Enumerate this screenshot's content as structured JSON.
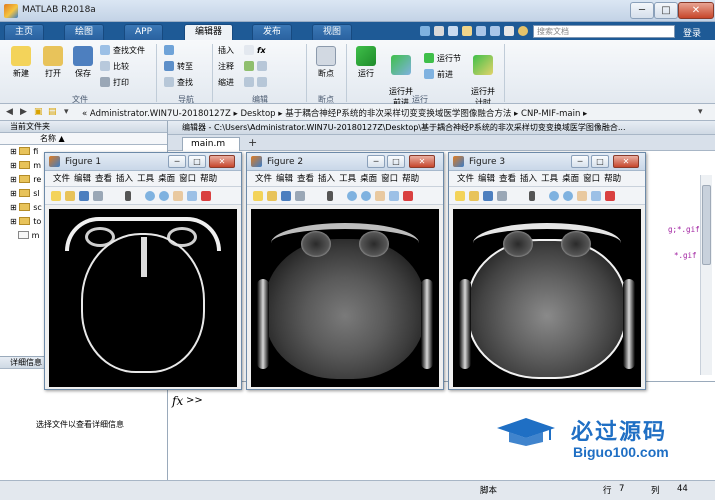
{
  "window": {
    "title": "MATLAB R2018a",
    "minimize": "─",
    "maximize": "□",
    "close": "✕"
  },
  "tabs": [
    {
      "label": "主页"
    },
    {
      "label": "绘图"
    },
    {
      "label": "APP"
    },
    {
      "label": "编辑器"
    },
    {
      "label": "发布"
    },
    {
      "label": "视图"
    }
  ],
  "search": {
    "placeholder": "搜索文档"
  },
  "login": "登录",
  "ribbon": {
    "file": {
      "new": "新建",
      "open": "打开",
      "save": "保存",
      "find_files": "查找文件",
      "compare": "比较",
      "print": "打印",
      "group": "文件"
    },
    "nav": {
      "goto": "转至",
      "find": "查找",
      "group": "导航"
    },
    "edit": {
      "insert": "插入",
      "comment": "注释",
      "indent": "缩进",
      "fx": "fx",
      "group": "编辑"
    },
    "breakpoint": {
      "label": "断点",
      "group": "断点"
    },
    "run": {
      "run": "运行",
      "run_advance": "运行并\n前进",
      "run_section": "运行节",
      "advance": "前进",
      "run_time": "运行并\n计时",
      "group": "运行"
    }
  },
  "address": {
    "path": "« Administrator.WIN7U-20180127Z  ▸  Desktop  ▸  基于耦合神经P系统的非次采样切变变换域医学图像融合方法  ▸  CNP-MIF-main  ▸"
  },
  "left_panel": {
    "title": "当前文件夹",
    "column": "名称",
    "sort": "▲",
    "items": [
      {
        "label": "fi"
      },
      {
        "label": "m"
      },
      {
        "label": "re"
      },
      {
        "label": "sl"
      },
      {
        "label": "sc"
      },
      {
        "label": "to"
      },
      {
        "label": "m"
      }
    ]
  },
  "detail_panel": {
    "title": "详细信息",
    "message": "选择文件以查看详细信息"
  },
  "editor": {
    "header": "编辑器 - C:\\Users\\Administrator.WIN7U-20180127Z\\Desktop\\基于耦合神经P系统的非次采样切变变换域医学图像融合...",
    "tab": "main.m",
    "add": "+",
    "code_fragments": [
      "g;*.gif",
      "*.gif"
    ]
  },
  "command": {
    "prompt": ">>"
  },
  "status": {
    "script": "脚本",
    "row_label": "行",
    "row": "7",
    "col_label": "列",
    "col": "44"
  },
  "figures": [
    {
      "title": "Figure 1"
    },
    {
      "title": "Figure 2"
    },
    {
      "title": "Figure 3"
    }
  ],
  "figure_menu": [
    "文件",
    "编辑",
    "查看",
    "插入",
    "工具",
    "桌面",
    "窗口",
    "帮助"
  ],
  "watermark": {
    "main": "必过源码",
    "sub": "Biguo100.com"
  },
  "colors": {
    "accent": "#1e5a96",
    "ribbon": "#eef2f6",
    "watermark": "#1f6fc4"
  }
}
